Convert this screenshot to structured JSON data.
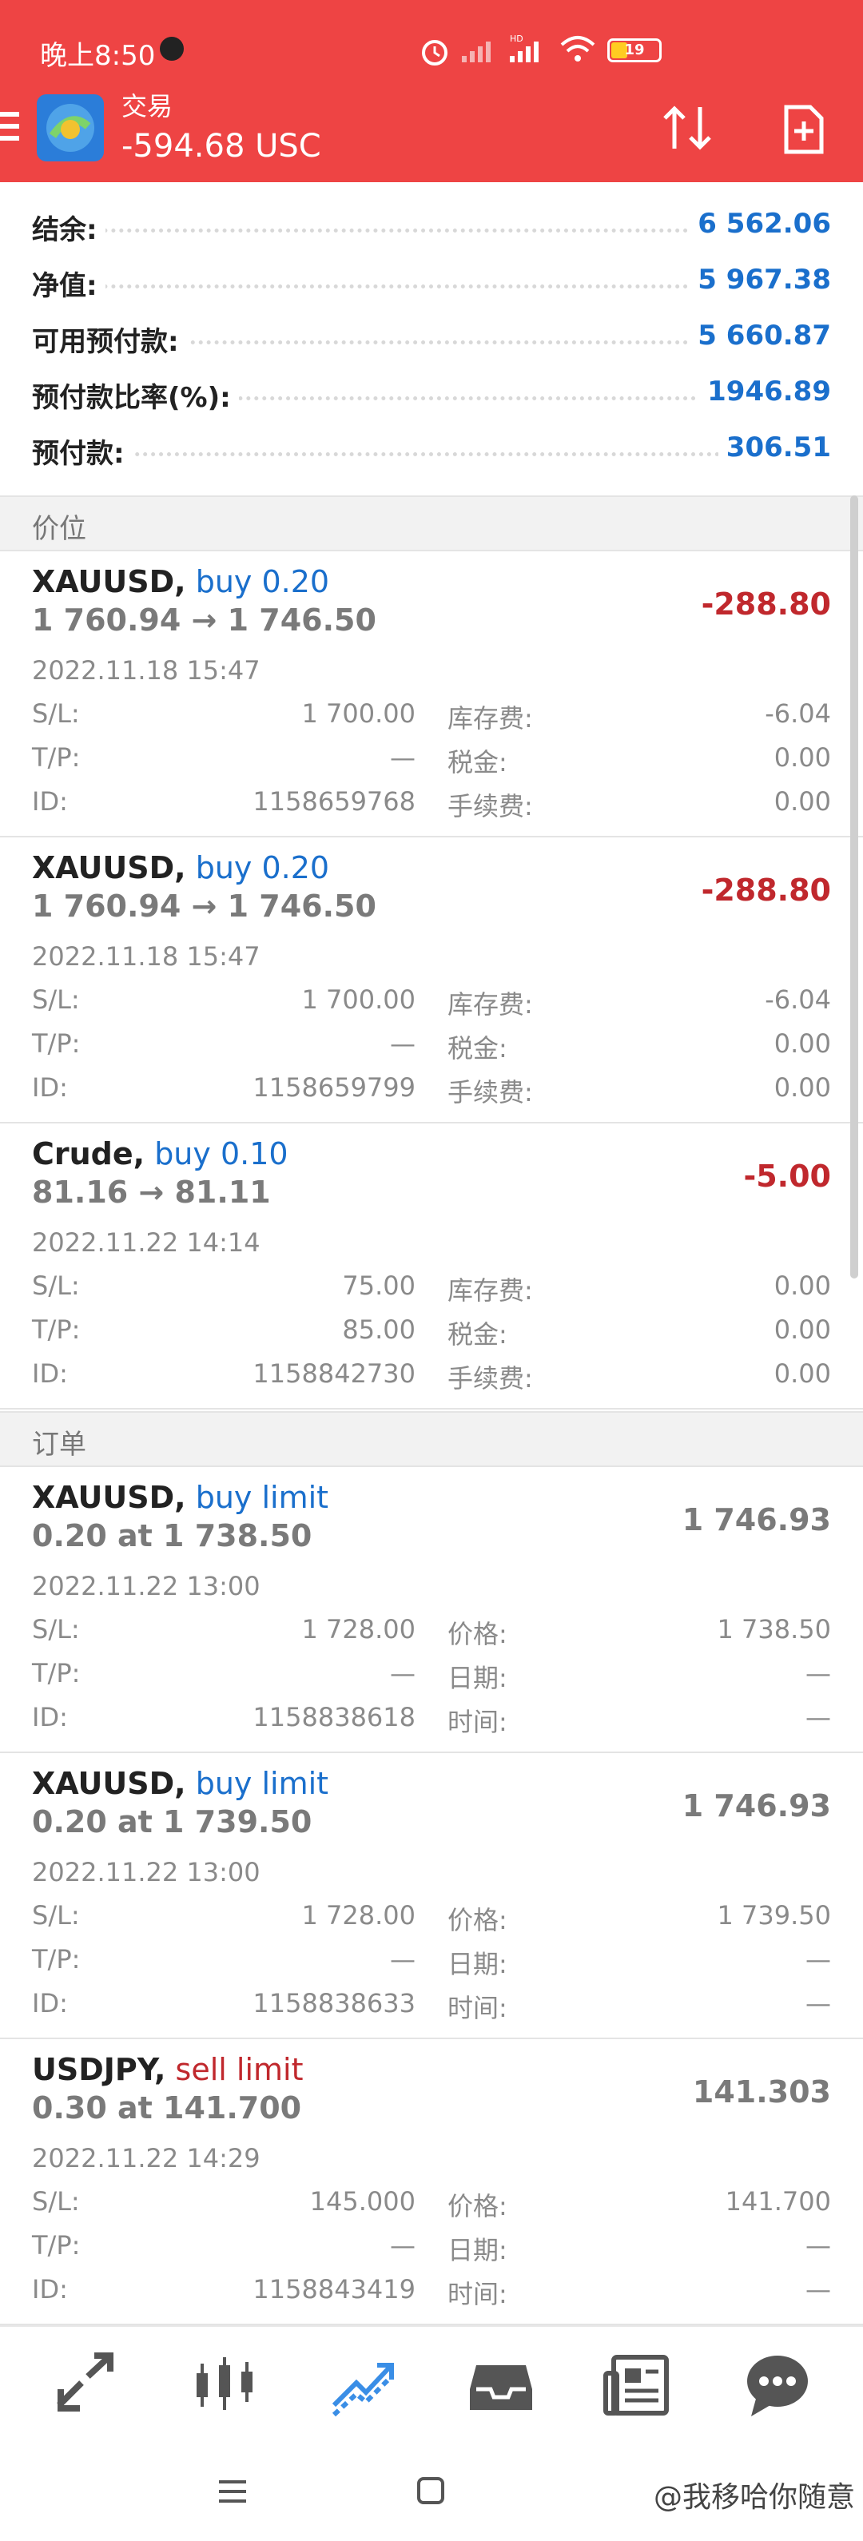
{
  "status": {
    "time": "晚上8:50",
    "battery": "19"
  },
  "header": {
    "title": "交易",
    "balance": "-594.68 USC"
  },
  "summary": [
    {
      "label": "结余:",
      "value": "6 562.06"
    },
    {
      "label": "净值:",
      "value": "5 967.38"
    },
    {
      "label": "可用预付款:",
      "value": "5 660.87"
    },
    {
      "label": "预付款比率(%):",
      "value": "1946.89"
    },
    {
      "label": "预付款:",
      "value": "306.51"
    }
  ],
  "sections": {
    "positions": "价位",
    "orders": "订单"
  },
  "positions": [
    {
      "symbol": "XAUUSD,",
      "type": "buy 0.20",
      "prices": "1 760.94 → 1 746.50",
      "profit": "-288.80",
      "date": "2022.11.18 15:47",
      "sl_label": "S/L:",
      "sl": "1 700.00",
      "tp_label": "T/P:",
      "tp": "—",
      "id_label": "ID:",
      "id": "1158659768",
      "swap_label": "库存费:",
      "swap": "-6.04",
      "tax_label": "税金:",
      "tax": "0.00",
      "fee_label": "手续费:",
      "fee": "0.00"
    },
    {
      "symbol": "XAUUSD,",
      "type": "buy 0.20",
      "prices": "1 760.94 → 1 746.50",
      "profit": "-288.80",
      "date": "2022.11.18 15:47",
      "sl_label": "S/L:",
      "sl": "1 700.00",
      "tp_label": "T/P:",
      "tp": "—",
      "id_label": "ID:",
      "id": "1158659799",
      "swap_label": "库存费:",
      "swap": "-6.04",
      "tax_label": "税金:",
      "tax": "0.00",
      "fee_label": "手续费:",
      "fee": "0.00"
    },
    {
      "symbol": "Crude,",
      "type": "buy 0.10",
      "prices": "81.16 → 81.11",
      "profit": "-5.00",
      "date": "2022.11.22 14:14",
      "sl_label": "S/L:",
      "sl": "75.00",
      "tp_label": "T/P:",
      "tp": "85.00",
      "id_label": "ID:",
      "id": "1158842730",
      "swap_label": "库存费:",
      "swap": "0.00",
      "tax_label": "税金:",
      "tax": "0.00",
      "fee_label": "手续费:",
      "fee": "0.00"
    }
  ],
  "orders": [
    {
      "symbol": "XAUUSD,",
      "type": "buy limit",
      "prices": "0.20 at 1 738.50",
      "current": "1 746.93",
      "date": "2022.11.22 13:00",
      "sl_label": "S/L:",
      "sl": "1 728.00",
      "tp_label": "T/P:",
      "tp": "—",
      "id_label": "ID:",
      "id": "1158838618",
      "price_label": "价格:",
      "price": "1 738.50",
      "date_label": "日期:",
      "date_val": "—",
      "time_label": "时间:",
      "time_val": "—"
    },
    {
      "symbol": "XAUUSD,",
      "type": "buy limit",
      "prices": "0.20 at 1 739.50",
      "current": "1 746.93",
      "date": "2022.11.22 13:00",
      "sl_label": "S/L:",
      "sl": "1 728.00",
      "tp_label": "T/P:",
      "tp": "—",
      "id_label": "ID:",
      "id": "1158838633",
      "price_label": "价格:",
      "price": "1 739.50",
      "date_label": "日期:",
      "date_val": "—",
      "time_label": "时间:",
      "time_val": "—"
    },
    {
      "symbol": "USDJPY,",
      "type": "sell limit",
      "prices": "0.30 at 141.700",
      "current": "141.303",
      "date": "2022.11.22 14:29",
      "sl_label": "S/L:",
      "sl": "145.000",
      "tp_label": "T/P:",
      "tp": "—",
      "id_label": "ID:",
      "id": "1158843419",
      "price_label": "价格:",
      "price": "141.700",
      "date_label": "日期:",
      "date_val": "—",
      "time_label": "时间:",
      "time_val": "—"
    }
  ],
  "watermark": "@我移哈你随意",
  "colors": {
    "header": "#ee4444",
    "blue": "#1a6fcc",
    "red": "#c0282d"
  },
  "bottom_nav": [
    "quotes-icon",
    "chart-icon",
    "trade-icon",
    "history-icon",
    "news-icon",
    "chat-icon"
  ]
}
